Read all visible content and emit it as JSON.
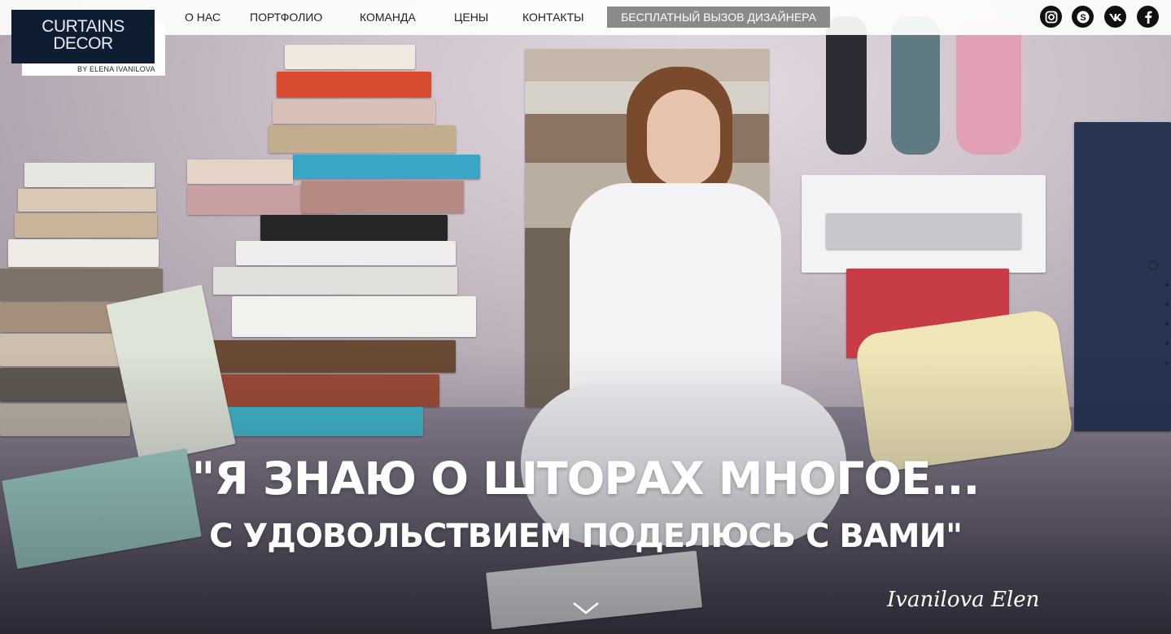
{
  "logo": {
    "line1": "CURTAINS",
    "line2": "DECOR",
    "sub": "BY ELENA IVANILOVA"
  },
  "nav": {
    "items": [
      {
        "label": "О НАС"
      },
      {
        "label": "ПОРТФОЛИО"
      },
      {
        "label": "КОМАНДА"
      },
      {
        "label": "ЦЕНЫ"
      },
      {
        "label": "КОНТАКТЫ"
      }
    ],
    "cta_label": "БЕСПЛАТНЫЙ ВЫЗОВ ДИЗАЙНЕРА"
  },
  "social": [
    {
      "name": "instagram-icon",
      "glyph": "◎"
    },
    {
      "name": "skype-icon",
      "glyph": "S"
    },
    {
      "name": "vk-icon",
      "glyph": "vk"
    },
    {
      "name": "facebook-icon",
      "glyph": "f"
    }
  ],
  "hero": {
    "quote_line1": "\"Я ЗНАЮ О ШТОРАХ МНОГОЕ...",
    "quote_line2": "С УДОВОЛЬСТВИЕМ ПОДЕЛЮСЬ С ВАМИ\"",
    "signature": "Ivanilova Elen"
  },
  "colors": {
    "logo_bg": "#0f1d33",
    "cta_bg": "#8a8a8a",
    "nav_text": "#1f1f1f"
  }
}
